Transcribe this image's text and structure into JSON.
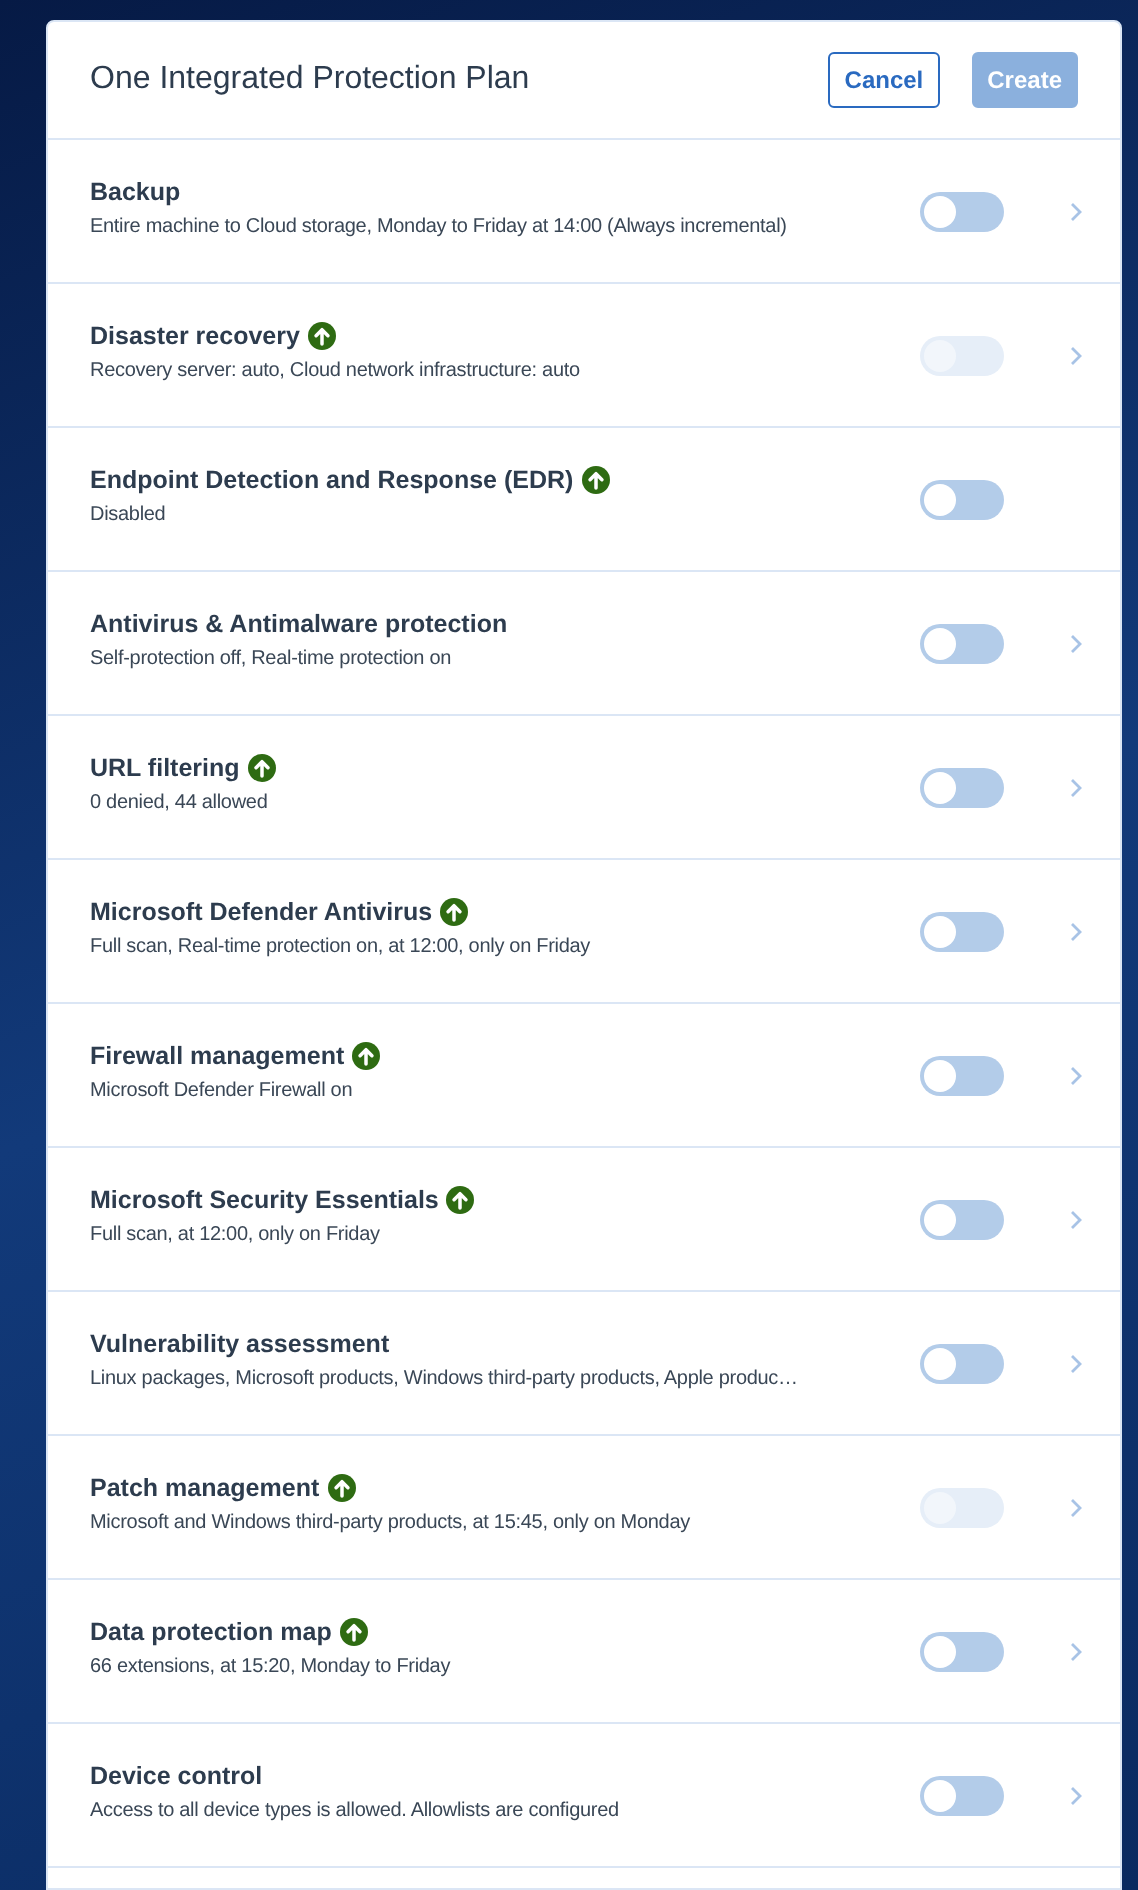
{
  "dialog": {
    "title": "One Integrated Protection Plan",
    "buttons": [
      {
        "label": "Cancel",
        "kind": "secondary",
        "disabled": false
      },
      {
        "label": "Create",
        "kind": "primary",
        "disabled": true
      }
    ]
  },
  "modules": [
    {
      "name": "Backup",
      "description": "Entire machine to Cloud storage, Monday to Friday at 14:00 (Always incremental)",
      "upgrade": false,
      "on": false,
      "disabled": false,
      "has_details": true
    },
    {
      "name": "Disaster recovery",
      "description": "Recovery server: auto, Cloud network infrastructure: auto",
      "upgrade": true,
      "on": false,
      "disabled": true,
      "has_details": true
    },
    {
      "name": "Endpoint Detection and Response (EDR)",
      "description": "Disabled",
      "upgrade": true,
      "on": false,
      "disabled": false,
      "has_details": false
    },
    {
      "name": "Antivirus & Antimalware protection",
      "description": "Self-protection off, Real-time protection on",
      "upgrade": false,
      "on": false,
      "disabled": false,
      "has_details": true
    },
    {
      "name": "URL filtering",
      "description": "0 denied, 44 allowed",
      "upgrade": true,
      "on": false,
      "disabled": false,
      "has_details": true
    },
    {
      "name": "Microsoft Defender Antivirus",
      "description": "Full scan, Real-time protection on, at 12:00, only on Friday",
      "upgrade": true,
      "on": false,
      "disabled": false,
      "has_details": true
    },
    {
      "name": "Firewall management",
      "description": "Microsoft Defender Firewall on",
      "upgrade": true,
      "on": false,
      "disabled": false,
      "has_details": true
    },
    {
      "name": "Microsoft Security Essentials",
      "description": "Full scan, at 12:00, only on Friday",
      "upgrade": true,
      "on": false,
      "disabled": false,
      "has_details": true
    },
    {
      "name": "Vulnerability assessment",
      "description": "Linux packages, Microsoft products, Windows third-party products, Apple produc…",
      "upgrade": false,
      "on": false,
      "disabled": false,
      "has_details": true
    },
    {
      "name": "Patch management",
      "description": "Microsoft and Windows third-party products, at 15:45, only on Monday",
      "upgrade": true,
      "on": false,
      "disabled": true,
      "has_details": true
    },
    {
      "name": "Data protection map",
      "description": "66 extensions, at 15:20, Monday to Friday",
      "upgrade": true,
      "on": false,
      "disabled": false,
      "has_details": true
    },
    {
      "name": "Device control",
      "description": "Access to all device types is allowed. Allowlists are configured",
      "upgrade": false,
      "on": false,
      "disabled": false,
      "has_details": true
    }
  ]
}
